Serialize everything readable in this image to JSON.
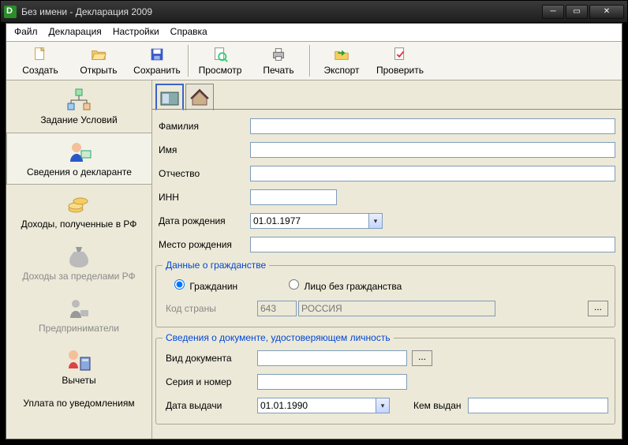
{
  "window": {
    "title": "Без имени - Декларация 2009"
  },
  "menu": {
    "file": "Файл",
    "declaration": "Декларация",
    "settings": "Настройки",
    "help": "Справка"
  },
  "toolbar": {
    "create": "Создать",
    "open": "Открыть",
    "save": "Сохранить",
    "preview": "Просмотр",
    "print": "Печать",
    "export": "Экспорт",
    "check": "Проверить"
  },
  "sidebar": {
    "conditions": "Задание Условий",
    "declarant": "Сведения о декларанте",
    "income_rf": "Доходы, полученные в РФ",
    "income_abroad": "Доходы за пределами РФ",
    "entrepreneurs": "Предприниматели",
    "deductions": "Вычеты",
    "payment_notice": "Уплата по уведомлениям"
  },
  "fields": {
    "surname": "Фамилия",
    "name": "Имя",
    "patronymic": "Отчество",
    "inn": "ИНН",
    "birth_date": "Дата рождения",
    "birth_date_value": "01.01.1977",
    "birth_place": "Место рождения"
  },
  "citizenship": {
    "legend": "Данные о гражданстве",
    "citizen": "Гражданин",
    "stateless": "Лицо без гражданства",
    "country_code_label": "Код страны",
    "country_code_value": "643",
    "country_name_value": "РОССИЯ"
  },
  "identity": {
    "legend": "Сведения о документе, удостоверяющем личность",
    "doc_type": "Вид документа",
    "series_number": "Серия и номер",
    "issue_date": "Дата выдачи",
    "issue_date_value": "01.01.1990",
    "issued_by": "Кем выдан"
  }
}
